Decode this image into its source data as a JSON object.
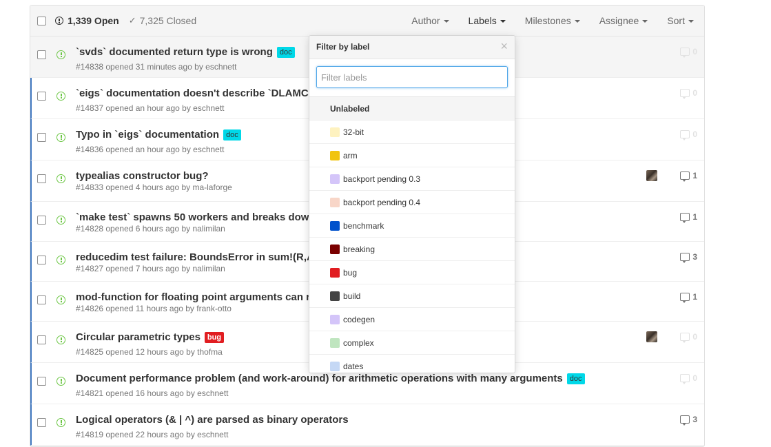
{
  "header": {
    "open_count": "1,339 Open",
    "closed_count": "7,325 Closed",
    "filters": {
      "author": "Author",
      "labels": "Labels",
      "milestones": "Milestones",
      "assignee": "Assignee",
      "sort": "Sort"
    }
  },
  "issues": [
    {
      "title": "`svds` documented return type is wrong",
      "label": "doc",
      "label_color": "#00d8e8",
      "meta": "#14838 opened 31 minutes ago by eschnett",
      "comments": "0"
    },
    {
      "title": "`eigs` documentation doesn't describe `DLAMC",
      "meta": "#14837 opened an hour ago by eschnett",
      "comments": "0"
    },
    {
      "title": "Typo in `eigs` documentation",
      "label": "doc",
      "label_color": "#00d8e8",
      "meta": "#14836 opened an hour ago by eschnett",
      "comments": "0"
    },
    {
      "title": "typealias constructor bug?",
      "meta": "#14833 opened 4 hours ago by ma-laforge",
      "comments": "1"
    },
    {
      "title": "`make test` spawns 50 workers and breaks dow",
      "meta": "#14828 opened 6 hours ago by nalimilan",
      "comments": "1"
    },
    {
      "title": "reducedim test failure: BoundsError in sum!(R,A",
      "meta": "#14827 opened 7 hours ago by nalimilan",
      "comments": "3"
    },
    {
      "title": "mod-function for floating point arguments can r",
      "meta": "#14826 opened 11 hours ago by frank-otto",
      "comments": "1"
    },
    {
      "title": "Circular parametric types",
      "label": "bug",
      "label_color": "#e11d21",
      "meta": "#14825 opened 12 hours ago by thofma",
      "comments": "0"
    },
    {
      "title": "Document performance problem (and work-around) for arithmetic operations with many arguments",
      "label": "doc",
      "label_color": "#00d8e8",
      "meta": "#14821 opened 16 hours ago by eschnett",
      "comments": "0"
    },
    {
      "title": "Logical operators (& | ^) are parsed as binary operators",
      "meta": "#14819 opened 22 hours ago by eschnett",
      "comments": "3"
    }
  ],
  "label_menu": {
    "title": "Filter by label",
    "filter_placeholder": "Filter labels",
    "unlabeled": "Unlabeled",
    "items": [
      {
        "name": "32-bit",
        "color": "#fef2c0"
      },
      {
        "name": "arm",
        "color": "#f1c40f"
      },
      {
        "name": "backport pending 0.3",
        "color": "#d4c5f9"
      },
      {
        "name": "backport pending 0.4",
        "color": "#f8d6c8"
      },
      {
        "name": "benchmark",
        "color": "#0052cc"
      },
      {
        "name": "breaking",
        "color": "#7a0000"
      },
      {
        "name": "bug",
        "color": "#e11d21"
      },
      {
        "name": "build",
        "color": "#444444"
      },
      {
        "name": "codegen",
        "color": "#d4c5f9"
      },
      {
        "name": "complex",
        "color": "#bfe5bf"
      },
      {
        "name": "dates",
        "color": "#c5d8f5"
      }
    ]
  }
}
